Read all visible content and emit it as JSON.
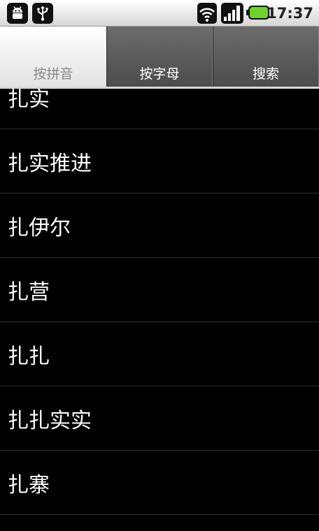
{
  "status_bar": {
    "left_icons": [
      "android-debug-icon",
      "usb-icon"
    ],
    "right_icons": [
      "wifi-icon",
      "signal-icon",
      "battery-icon"
    ],
    "time": "17:37",
    "battery_color": "#6fd12b"
  },
  "tabs": [
    {
      "label": "按拼音",
      "active": true
    },
    {
      "label": "按字母",
      "active": false
    },
    {
      "label": "搜索",
      "active": false
    }
  ],
  "list": {
    "items": [
      "扎实",
      "扎实推进",
      "扎伊尔",
      "扎营",
      "扎扎",
      "扎扎实实",
      "扎寨"
    ]
  }
}
